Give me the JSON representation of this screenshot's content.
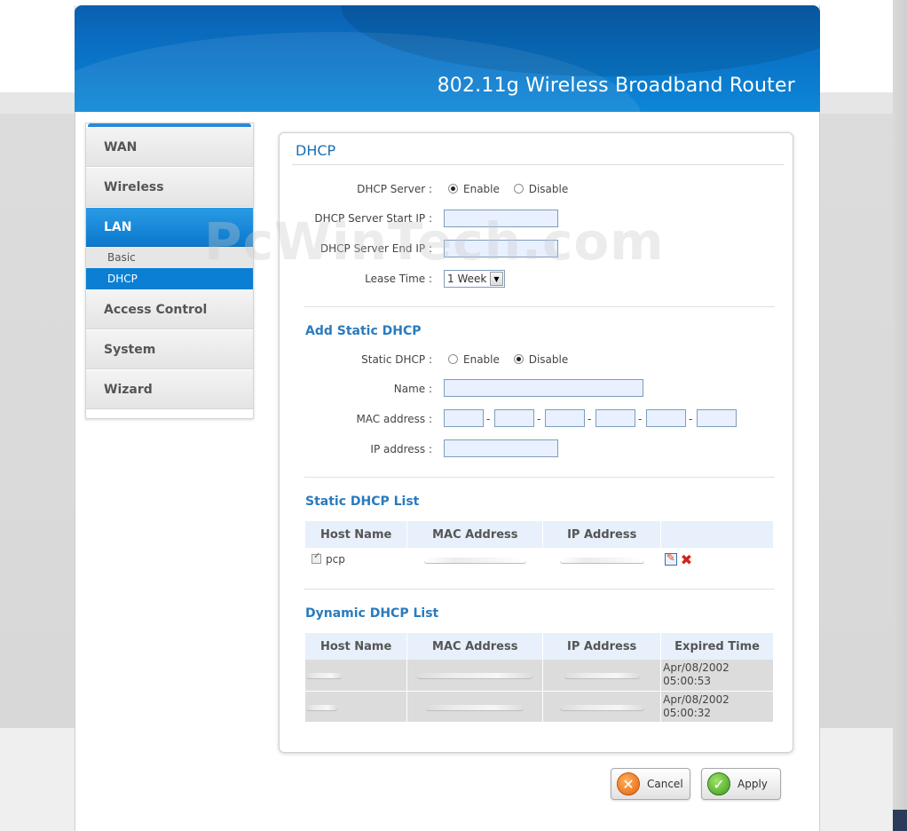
{
  "header": {
    "title": "802.11g Wireless Broadband Router"
  },
  "watermark": "PcWinTech.com",
  "sidebar": {
    "items": [
      {
        "label": "WAN"
      },
      {
        "label": "Wireless"
      },
      {
        "label": "LAN"
      },
      {
        "label": "Access Control"
      },
      {
        "label": "System"
      },
      {
        "label": "Wizard"
      }
    ],
    "lan_sub": [
      {
        "label": "Basic"
      },
      {
        "label": "DHCP"
      }
    ]
  },
  "panel": {
    "title": "DHCP",
    "dhcp_server": {
      "label": "DHCP Server :",
      "enable": "Enable",
      "disable": "Disable",
      "selected": "Enable"
    },
    "start_ip": {
      "label": "DHCP Server Start IP :",
      "value": ""
    },
    "end_ip": {
      "label": "DHCP Server End IP :",
      "value": ""
    },
    "lease": {
      "label": "Lease Time :",
      "value": "1 Week"
    },
    "add_static": {
      "title": "Add Static DHCP",
      "static_label": "Static DHCP :",
      "enable": "Enable",
      "disable": "Disable",
      "selected": "Disable",
      "name_label": "Name :",
      "mac_label": "MAC address :",
      "ip_label": "IP address :",
      "sep": "-"
    },
    "static_list": {
      "title": "Static DHCP List",
      "columns": [
        "Host Name",
        "MAC Address",
        "IP Address",
        ""
      ],
      "rows": [
        {
          "host": "pcp"
        }
      ]
    },
    "dynamic_list": {
      "title": "Dynamic DHCP List",
      "columns": [
        "Host Name",
        "MAC Address",
        "IP Address",
        "Expired Time"
      ],
      "rows": [
        {
          "expired_date": "Apr/08/2002",
          "expired_time": "05:00:53"
        },
        {
          "expired_date": "Apr/08/2002",
          "expired_time": "05:00:32"
        }
      ]
    }
  },
  "buttons": {
    "cancel": "Cancel",
    "apply": "Apply"
  }
}
